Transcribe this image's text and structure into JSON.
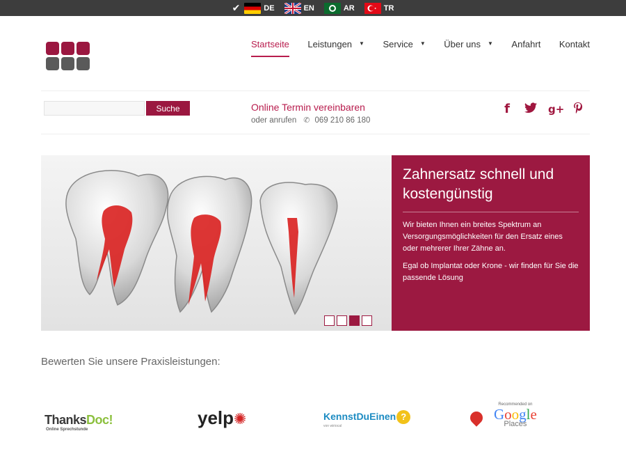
{
  "languages": [
    {
      "code": "DE",
      "icon": "german-flag-icon",
      "selected": true
    },
    {
      "code": "EN",
      "icon": "uk-flag-icon"
    },
    {
      "code": "AR",
      "icon": "saudi-flag-icon"
    },
    {
      "code": "TR",
      "icon": "turkish-flag-icon"
    }
  ],
  "nav": {
    "home": "Startseite",
    "services": "Leistungen",
    "service": "Service",
    "about": "Über uns",
    "directions": "Anfahrt",
    "contact": "Kontakt"
  },
  "search": {
    "placeholder": "",
    "button": "Suche"
  },
  "appointment": {
    "link": "Online Termin vereinbaren",
    "call_prefix": "oder anrufen",
    "phone": "069 210 86 180"
  },
  "hero": {
    "title": "Zahnersatz schnell und kostengünstig",
    "para1": "Wir bieten Ihnen ein breites Spektrum an Versorgungsmöglichkeiten für den Ersatz eines oder mehrerer Ihrer Zähne an.",
    "para2": "Egal ob Implantat oder Krone - wir finden für Sie die passende Lösung",
    "slides_total": 4,
    "active_slide": 3
  },
  "rating": {
    "title": "Bewerten Sie unsere Praxisleistungen:"
  },
  "review_sites": {
    "thanksdoc": {
      "name_a": "Thanks",
      "name_b": "Doc!",
      "tagline": "Online Sprechstunde"
    },
    "yelp": {
      "name": "yelp"
    },
    "kennstdueinen": {
      "name": "KennstDuEinen",
      "sub": "von wiriocal"
    },
    "google": {
      "recommended": "Recommended on",
      "brand": "Google",
      "places": "Places"
    }
  },
  "colors": {
    "brand": "#9c1941",
    "accent_text": "#b81c4d",
    "topbar": "#3d3d3d"
  }
}
